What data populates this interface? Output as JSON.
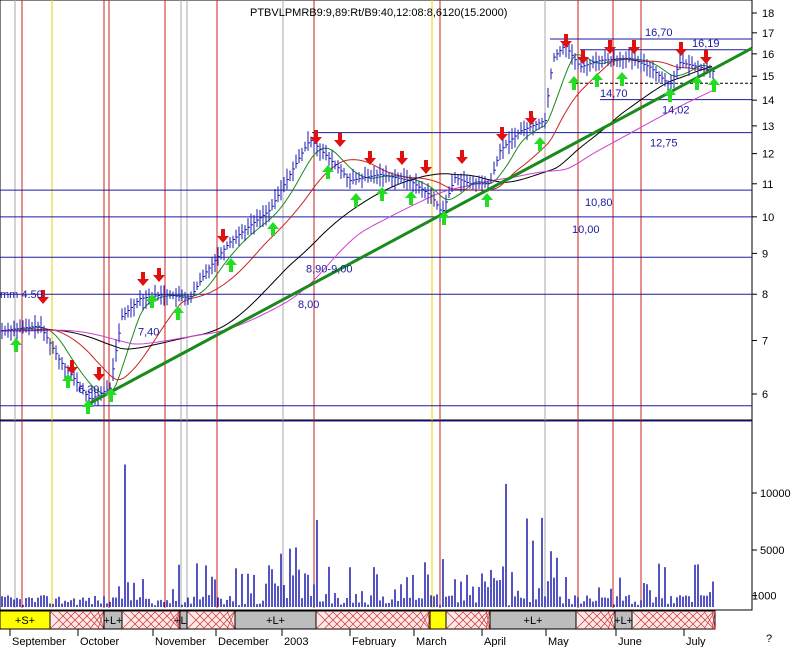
{
  "chart_data": {
    "type": "candlestick",
    "title": "PTBVLPMRB9:9,89:Rt/B9:40,12:08:8,6120(15.2000)",
    "corner_mark": "?",
    "y_axis": {
      "ticks": [
        6,
        7,
        8,
        9,
        10,
        11,
        12,
        13,
        14,
        15,
        16,
        17,
        18
      ],
      "range": [
        5.4,
        18.3
      ],
      "scale": "log"
    },
    "volume_axis": {
      "ticks": [
        1000,
        5000,
        10000
      ],
      "range": [
        0,
        14000
      ]
    },
    "months": [
      "September",
      "October",
      "November",
      "December",
      "2003",
      "February",
      "March",
      "April",
      "May",
      "June",
      "July"
    ],
    "signal_segments": [
      {
        "label": "",
        "style": "hatch"
      },
      {
        "label": "+S+",
        "style": "yellow"
      },
      {
        "label": "",
        "style": "hatch"
      },
      {
        "label": "+L+",
        "style": "gray"
      },
      {
        "label": "",
        "style": "hatch"
      },
      {
        "label": "+L+",
        "style": "gray"
      },
      {
        "label": "",
        "style": "hatch"
      },
      {
        "label": "+L+",
        "style": "gray"
      },
      {
        "label": "",
        "style": "hatch"
      },
      {
        "label": "",
        "style": "yellow"
      },
      {
        "label": "",
        "style": "hatch"
      },
      {
        "label": "+L+",
        "style": "gray"
      },
      {
        "label": "",
        "style": "hatch"
      },
      {
        "label": "+L+",
        "style": "gray"
      },
      {
        "label": "",
        "style": "hatch"
      }
    ],
    "levels": [
      {
        "value": 16.7,
        "label": "16,70"
      },
      {
        "value": 16.19,
        "label": "16,19"
      },
      {
        "value": 14.7,
        "label": "14,70"
      },
      {
        "value": 14.02,
        "label": "14,02"
      },
      {
        "value": 12.75,
        "label": "12,75"
      },
      {
        "value": 10.8,
        "label": "10,80"
      },
      {
        "value": 10.0,
        "label": "10,00"
      },
      {
        "value": 8.9,
        "label": "8,90-9,00"
      },
      {
        "value": 8.0,
        "label": "8,00"
      },
      {
        "value": 7.4,
        "label": "7,40"
      }
    ],
    "extra_labels": [
      "mm 4.50",
      "6,30"
    ],
    "series": [
      {
        "name": "",
        "style": "short moving average (green)"
      },
      {
        "name": "",
        "style": "medium moving average (red)"
      },
      {
        "name": "",
        "style": "long moving average (black)"
      },
      {
        "name": "",
        "style": "longest moving average (magenta)"
      }
    ],
    "trend_line": {
      "from_value": 5.8,
      "to_value": 15.8
    },
    "colors": {
      "up_arrow": "#22dd22",
      "down_arrow": "#e01010",
      "price": "#1a1ab0",
      "trend": "#1a8a1a",
      "vline_red": "#cc2222",
      "vline_yellow": "#e8d000"
    }
  }
}
